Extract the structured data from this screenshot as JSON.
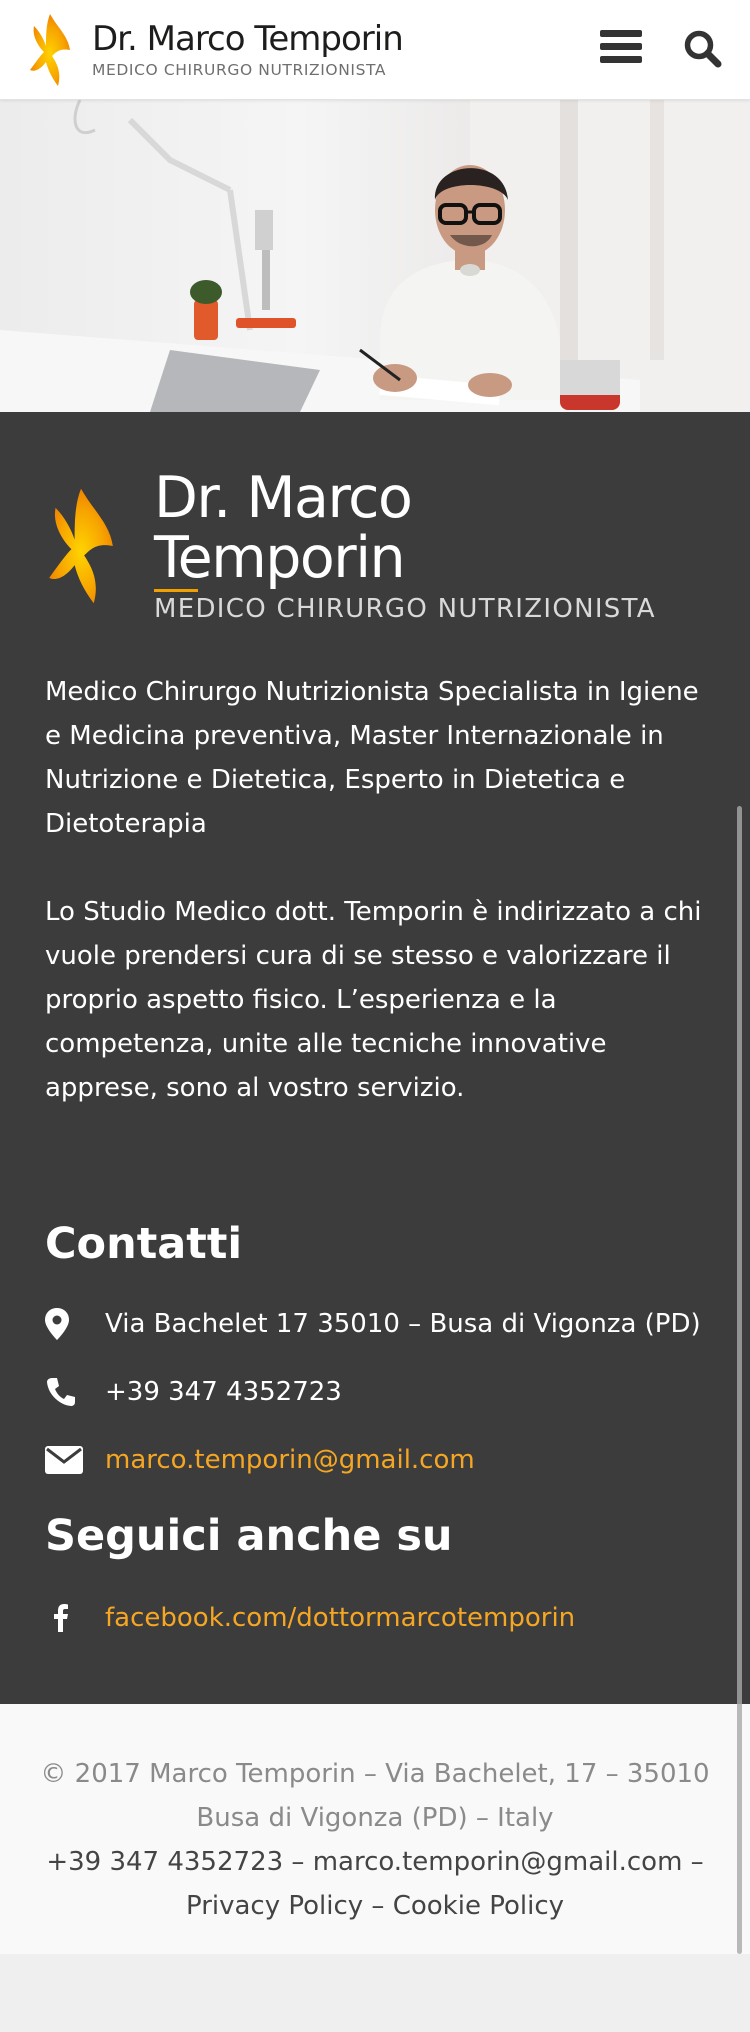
{
  "header": {
    "brand_name": "Dr. Marco Temporin",
    "brand_subtitle": "MEDICO CHIRURGO NUTRIZIONISTA",
    "menu_icon": "hamburger-menu-icon",
    "search_icon": "search-icon"
  },
  "hero": {
    "image": "doctor-writing-at-desk-photo"
  },
  "footer_about": {
    "brand_name": "Dr. Marco Temporin",
    "brand_subtitle": "MEDICO CHIRURGO NUTRIZIONISTA",
    "paragraph1": "Medico Chirurgo Nutrizionista Specialista in Igiene e Medicina preventiva, Master Internazionale in Nutrizione e Dietetica, Esperto in Dietetica e Dietoterapia",
    "paragraph2": "Lo Studio Medico dott. Temporin è indirizzato a chi vuole prendersi cura di se stesso e valorizzare il proprio aspetto fisico. L’esperienza e la competenza, unite alle tecniche innovative apprese, sono al vostro servizio."
  },
  "contacts": {
    "title": "Contatti",
    "address": "Via Bachelet 17 35010 – Busa di Vigonza (PD)",
    "phone": "+39 347 4352723",
    "email": "marco.temporin@gmail.com"
  },
  "social": {
    "title": "Seguici anche su",
    "facebook": "facebook.com/dottormarcotemporin"
  },
  "bottom": {
    "copyright": "© 2017 Marco Temporin – Via Bachelet, 17 – 35010 Busa di Vigonza (PD) – Italy",
    "phone": "+39 347 4352723",
    "separator1": " – ",
    "email": "marco.temporin@gmail.com",
    "separator2": " –",
    "privacy": "Privacy Policy",
    "separator3": " – ",
    "cookie": "Cookie Policy"
  },
  "colors": {
    "accent": "#f5a623",
    "dark_bg": "#3d3c3c",
    "header_bg": "#ffffff"
  }
}
